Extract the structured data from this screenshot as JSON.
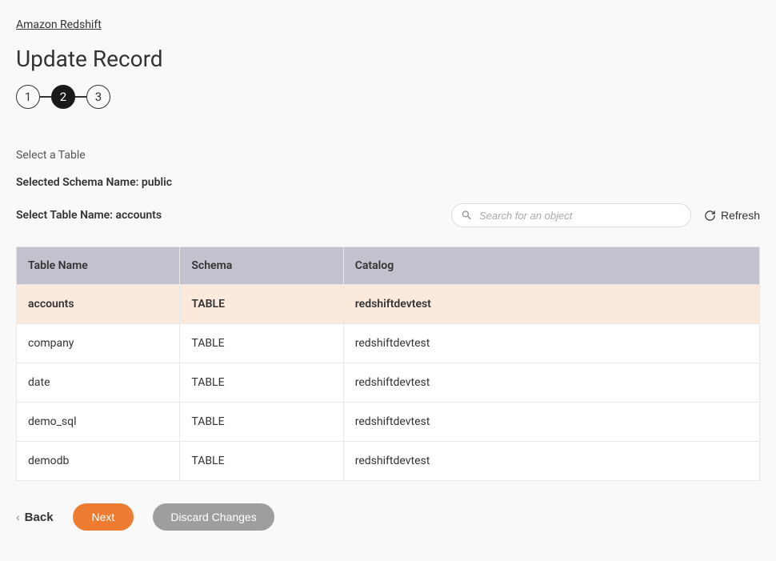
{
  "breadcrumb": {
    "label": "Amazon Redshift"
  },
  "page": {
    "title": "Update Record"
  },
  "stepper": {
    "steps": [
      "1",
      "2",
      "3"
    ],
    "active_index": 1
  },
  "section": {
    "select_table_label": "Select a Table",
    "schema_line": "Selected Schema Name: public",
    "table_line": "Select Table Name: accounts"
  },
  "search": {
    "placeholder": "Search for an object"
  },
  "refresh": {
    "label": "Refresh"
  },
  "table": {
    "headers": {
      "name": "Table Name",
      "schema": "Schema",
      "catalog": "Catalog"
    },
    "rows": [
      {
        "name": "accounts",
        "schema": "TABLE",
        "catalog": "redshiftdevtest",
        "selected": true
      },
      {
        "name": "company",
        "schema": "TABLE",
        "catalog": "redshiftdevtest",
        "selected": false
      },
      {
        "name": "date",
        "schema": "TABLE",
        "catalog": "redshiftdevtest",
        "selected": false
      },
      {
        "name": "demo_sql",
        "schema": "TABLE",
        "catalog": "redshiftdevtest",
        "selected": false
      },
      {
        "name": "demodb",
        "schema": "TABLE",
        "catalog": "redshiftdevtest",
        "selected": false
      }
    ]
  },
  "actions": {
    "back": "Back",
    "next": "Next",
    "discard": "Discard Changes"
  }
}
